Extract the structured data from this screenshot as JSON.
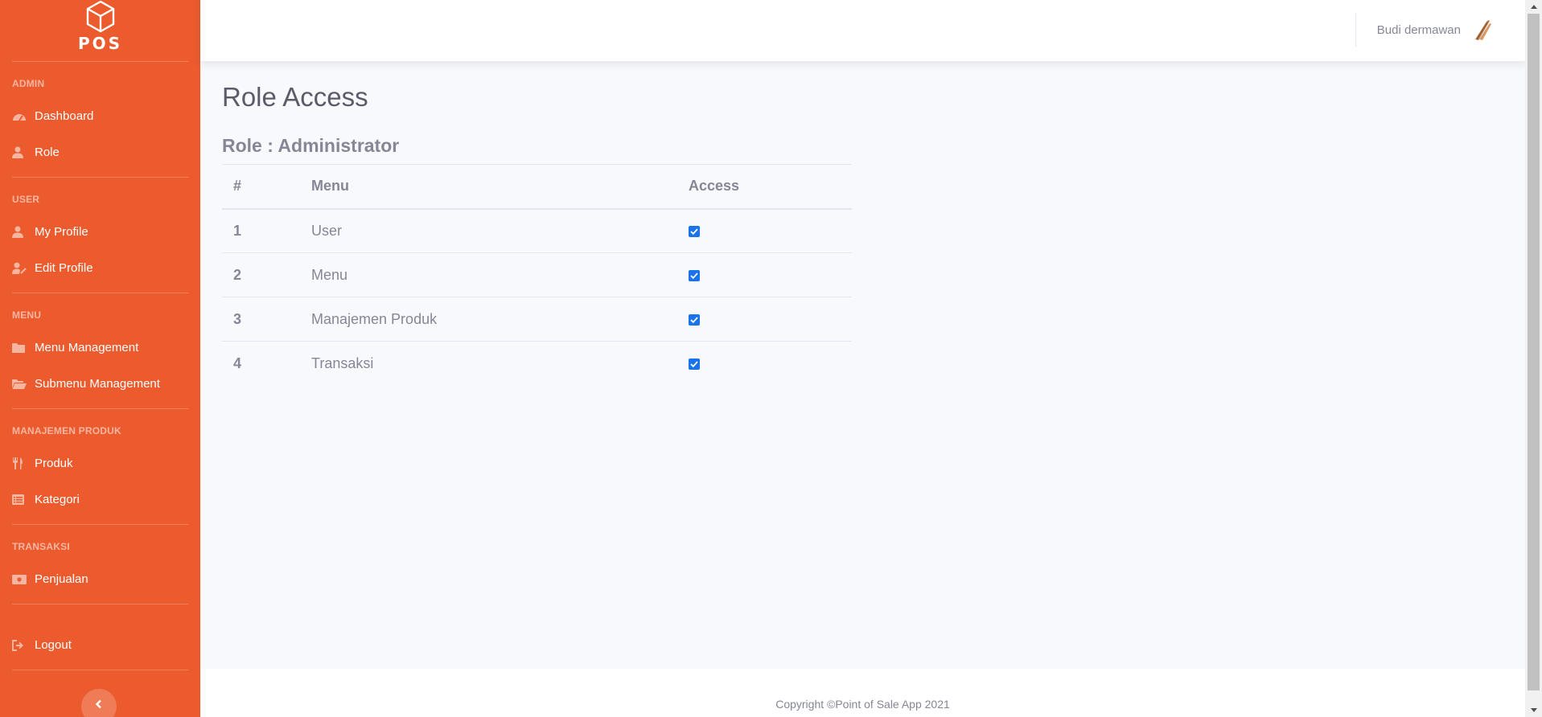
{
  "brand": {
    "text": "POS",
    "icon": "box-icon"
  },
  "sidebar": {
    "sections": [
      {
        "heading": "ADMIN",
        "items": [
          {
            "label": "Dashboard",
            "icon": "dashboard-icon"
          },
          {
            "label": "Role",
            "icon": "user-tie-icon"
          }
        ]
      },
      {
        "heading": "USER",
        "items": [
          {
            "label": "My Profile",
            "icon": "user-icon"
          },
          {
            "label": "Edit Profile",
            "icon": "user-edit-icon"
          }
        ]
      },
      {
        "heading": "MENU",
        "items": [
          {
            "label": "Menu Management",
            "icon": "folder-icon"
          },
          {
            "label": "Submenu Management",
            "icon": "folder-open-icon"
          }
        ]
      },
      {
        "heading": "MANAJEMEN PRODUK",
        "items": [
          {
            "label": "Produk",
            "icon": "utensils-icon"
          },
          {
            "label": "Kategori",
            "icon": "list-icon"
          }
        ]
      },
      {
        "heading": "TRANSAKSI",
        "items": [
          {
            "label": "Penjualan",
            "icon": "money-bill-icon"
          }
        ]
      }
    ],
    "logout": {
      "label": "Logout",
      "icon": "sign-out-icon"
    }
  },
  "topbar": {
    "user_name": "Budi dermawan"
  },
  "main": {
    "title": "Role Access",
    "role_line": "Role : Administrator",
    "table": {
      "headers": [
        "#",
        "Menu",
        "Access"
      ],
      "rows": [
        {
          "no": "1",
          "menu": "User",
          "access": true
        },
        {
          "no": "2",
          "menu": "Menu",
          "access": true
        },
        {
          "no": "3",
          "menu": "Manajemen Produk",
          "access": true
        },
        {
          "no": "4",
          "menu": "Transaksi",
          "access": true
        }
      ]
    }
  },
  "footer": {
    "text": "Copyright ©Point of Sale App 2021"
  },
  "colors": {
    "sidebar": "#ec5b2e",
    "accent_checkbox": "#1a73e8",
    "text": "#858796"
  }
}
